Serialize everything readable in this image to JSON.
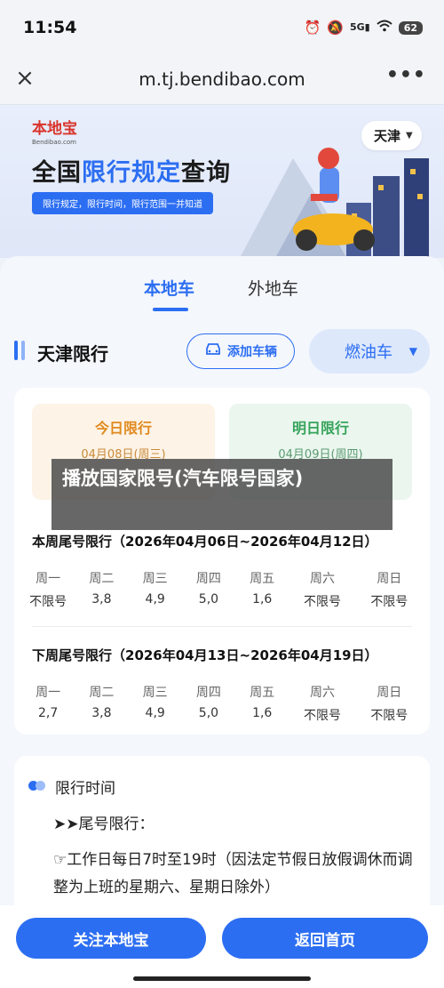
{
  "status": {
    "time": "11:54",
    "battery": "62",
    "icons": [
      "alarm-icon",
      "mute-icon",
      "signal-5g-icon",
      "wifi-icon",
      "battery-icon"
    ]
  },
  "browser": {
    "url": "m.tj.bendibao.com"
  },
  "banner": {
    "logo": "本地宝",
    "logo_sub": "Bendibao.com",
    "title_prefix": "全国",
    "title_highlight": "限行规定",
    "title_suffix": "查询",
    "desc": "限行规定，限行时间，限行范围一并知道",
    "city": "天津"
  },
  "tabs": [
    {
      "label": "本地车",
      "active": true
    },
    {
      "label": "外地车",
      "active": false
    }
  ],
  "section": {
    "title": "天津限行",
    "add_car": "添加车辆",
    "fuel_type": "燃油车"
  },
  "today": {
    "label": "今日限行",
    "date": "04月08日(周三)"
  },
  "tomorrow": {
    "label": "明日限行",
    "date": "04月09日(周四)"
  },
  "overlay": {
    "text": "播放国家限号(汽车限号国家)"
  },
  "this_week": {
    "title": "本周尾号限行（2026年04月06日~2026年04月12日）",
    "days": [
      "周一",
      "周二",
      "周三",
      "周四",
      "周五",
      "周六",
      "周日"
    ],
    "values": [
      "不限号",
      "3,8",
      "4,9",
      "5,0",
      "1,6",
      "不限号",
      "不限号"
    ]
  },
  "next_week": {
    "title": "下周尾号限行（2026年04月13日~2026年04月19日）",
    "days": [
      "周一",
      "周二",
      "周三",
      "周四",
      "周五",
      "周六",
      "周日"
    ],
    "values": [
      "2,7",
      "3,8",
      "4,9",
      "5,0",
      "1,6",
      "不限号",
      "不限号"
    ]
  },
  "time_section": {
    "title": "限行时间",
    "subtitle": "➤➤尾号限行：",
    "text": "☞工作日每日7时至19时（因法定节假日放假调休而调整为上班的星期六、星期日除外）"
  },
  "bottom": {
    "follow": "关注本地宝",
    "home": "返回首页"
  },
  "colors": {
    "accent": "#2c6ef2",
    "today_bg": "#fdf3e6",
    "tomorrow_bg": "#eaf6ee"
  }
}
